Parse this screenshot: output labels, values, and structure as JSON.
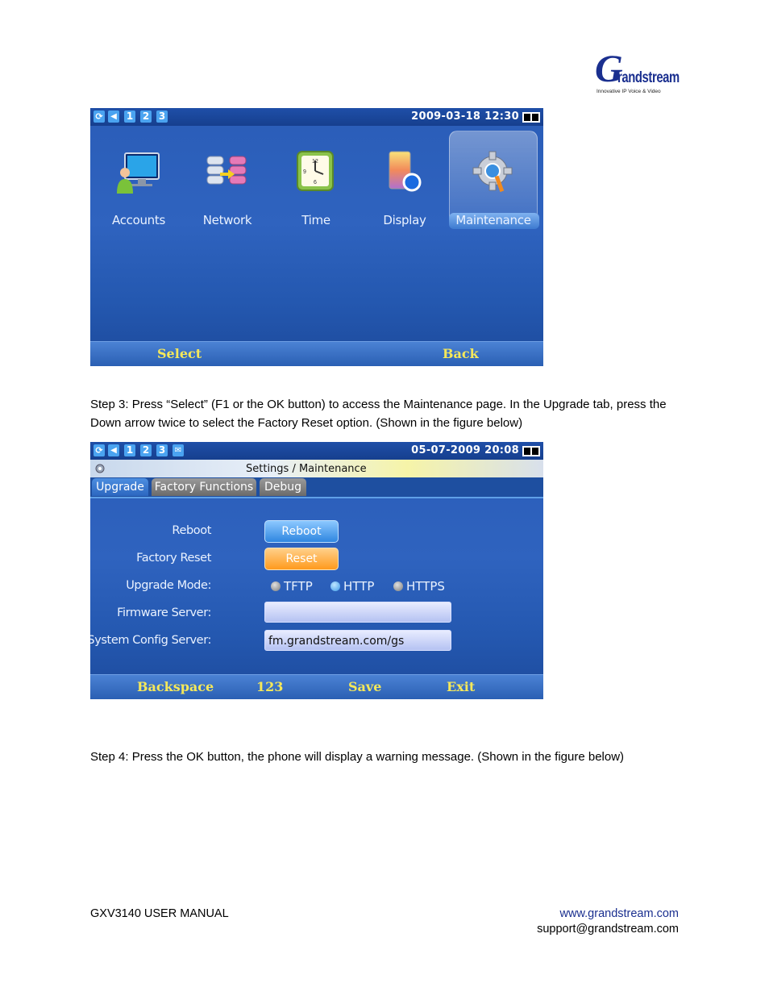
{
  "logo": {
    "brand": "Grandstream",
    "g_letter": "G",
    "word": "randstream",
    "tagline": "Innovative IP Voice & Video"
  },
  "screen1": {
    "topbar": {
      "icons": [
        "refresh-icon",
        "speaker-icon"
      ],
      "lines": [
        "1",
        "2",
        "3"
      ],
      "datetime": "2009-03-18 12:30"
    },
    "apps": [
      {
        "label": "Accounts",
        "icon": "accounts-icon"
      },
      {
        "label": "Network",
        "icon": "network-icon"
      },
      {
        "label": "Time",
        "icon": "clock-icon"
      },
      {
        "label": "Display",
        "icon": "display-icon"
      },
      {
        "label": "Maintenance",
        "icon": "gear-icon",
        "selected": true
      }
    ],
    "softkeys": {
      "left": "Select",
      "right": "Back"
    }
  },
  "step3": "Step 3: Press “Select” (F1 or the OK button) to access the Maintenance page. In the Upgrade tab, press the Down arrow twice to select the Factory Reset option. (Shown in the figure below)",
  "screen2": {
    "topbar": {
      "lines": [
        "1",
        "2",
        "3"
      ],
      "datetime": "05-07-2009 20:08"
    },
    "title": "Settings / Maintenance",
    "tabs": [
      "Upgrade",
      "Factory Functions",
      "Debug"
    ],
    "form": {
      "reboot_label": "Reboot",
      "reboot_button": "Reboot",
      "factory_label": "Factory Reset",
      "reset_button": "Reset",
      "upgrade_label": "Upgrade Mode:",
      "modes": [
        "TFTP",
        "HTTP",
        "HTTPS"
      ],
      "selected_mode": "HTTP",
      "firmware_label": "Firmware Server:",
      "firmware_value": "",
      "config_label": "System Config Server:",
      "config_value": "fm.grandstream.com/gs"
    },
    "softkeys": [
      "Backspace",
      "123",
      "Save",
      "Exit"
    ]
  },
  "step4": "Step 4: Press the OK button, the phone will display a warning message. (Shown in the figure below)",
  "footer": {
    "left": "GXV3140 USER MANUAL",
    "url": "www.grandstream.com",
    "email": "support@grandstream.com",
    "url_color": "#1a2f8f"
  }
}
